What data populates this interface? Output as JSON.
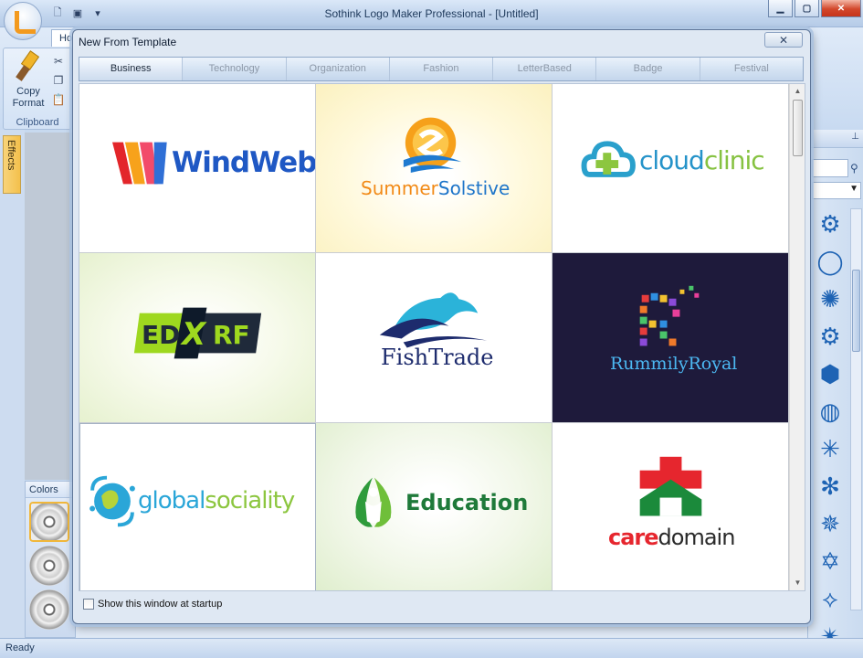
{
  "app": {
    "title": "Sothink Logo Maker Professional - [Untitled]",
    "ribbon_tab": "Ho",
    "copy_format_label": "Copy Format",
    "clipboard_label": "Clipboard",
    "effects_label": "Effects",
    "colors_label": "Colors",
    "status": "Ready",
    "window_controls": [
      "minimize-icon",
      "restore-icon",
      "close-icon"
    ]
  },
  "dialog": {
    "title": "New From Template",
    "close_glyph": "✕",
    "categories": [
      {
        "label": "Business",
        "active": true
      },
      {
        "label": "Technology",
        "active": false
      },
      {
        "label": "Organization",
        "active": false
      },
      {
        "label": "Fashion",
        "active": false
      },
      {
        "label": "LetterBased",
        "active": false
      },
      {
        "label": "Badge",
        "active": false
      },
      {
        "label": "Festival",
        "active": false
      }
    ],
    "templates": [
      {
        "name": "WindWeb"
      },
      {
        "name": "SummerSolstive",
        "parts": [
          "Summer",
          "Solstive"
        ]
      },
      {
        "name": "cloudclinic",
        "parts": [
          "cloud",
          "clinic"
        ]
      },
      {
        "name": "EDXRF",
        "parts": [
          "ED",
          "X",
          "RF"
        ]
      },
      {
        "name": "FishTrade"
      },
      {
        "name": "RummilyRoyal"
      },
      {
        "name": "globalsociality",
        "parts": [
          "global",
          "sociality"
        ]
      },
      {
        "name": "Education"
      },
      {
        "name": "caredomain",
        "parts": [
          "care",
          "domain"
        ]
      }
    ],
    "show_at_startup_label": "Show this window at startup",
    "show_at_startup_checked": false
  },
  "colors": {
    "accent": "#1e63b4",
    "orange": "#f39a1e",
    "active_tab_text": "#1d2a3b",
    "inactive_tab_text": "#8b97a7"
  }
}
